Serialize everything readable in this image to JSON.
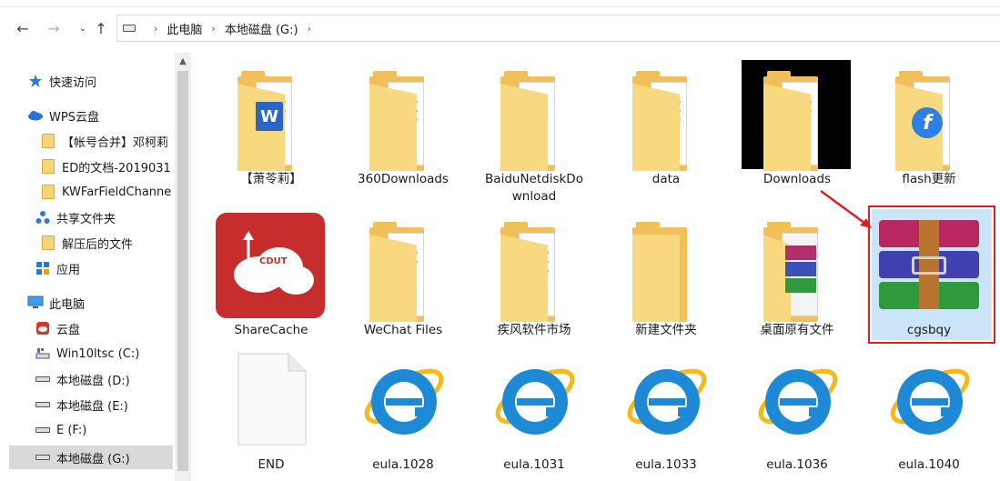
{
  "breadcrumb": [
    "此电脑",
    "本地磁盘 (G:)"
  ],
  "sidebar": {
    "items": [
      {
        "label": "快速访问",
        "icon": "pin-icon"
      },
      {
        "label": "WPS云盘",
        "icon": "cloud-icon"
      },
      {
        "label": "【帐号合并】邓柯莉",
        "icon": "folder-icon"
      },
      {
        "label": "ED的文档-2019031",
        "icon": "folder-icon"
      },
      {
        "label": "KWFarFieldChanne",
        "icon": "folder-icon"
      },
      {
        "label": "共享文件夹",
        "icon": "share-icon"
      },
      {
        "label": "解压后的文件",
        "icon": "folder-icon"
      },
      {
        "label": "应用",
        "icon": "apps-icon"
      },
      {
        "label": "此电脑",
        "icon": "computer-icon"
      },
      {
        "label": "云盘",
        "icon": "cloud-drive-icon"
      },
      {
        "label": "Win10ltsc (C:)",
        "icon": "system-drive-icon"
      },
      {
        "label": "本地磁盘 (D:)",
        "icon": "drive-icon"
      },
      {
        "label": "本地磁盘 (E:)",
        "icon": "drive-icon"
      },
      {
        "label": "E (F:)",
        "icon": "drive-icon"
      },
      {
        "label": "本地磁盘 (G:)",
        "icon": "drive-icon"
      }
    ],
    "selected": "本地磁盘 (G:)"
  },
  "files": [
    {
      "label": "【萧苓莉】",
      "icon": "word-folder-icon"
    },
    {
      "label": "360Downloads",
      "icon": "folder-icon"
    },
    {
      "label": "BaiduNetdiskDo",
      "label2": "wnload",
      "icon": "folder-icon"
    },
    {
      "label": "data",
      "icon": "folder-icon"
    },
    {
      "label": "Downloads",
      "icon": "folder-icon"
    },
    {
      "label": "flash更新",
      "icon": "flash-folder-icon"
    },
    {
      "label": "ShareCache",
      "icon": "sharecache-icon"
    },
    {
      "label": "WeChat Files",
      "icon": "folder-icon"
    },
    {
      "label": "疾风软件市场",
      "icon": "folder-icon"
    },
    {
      "label": "新建文件夹",
      "icon": "folder-icon"
    },
    {
      "label": "桌面原有文件",
      "icon": "winrar-folder-icon"
    },
    {
      "label": "cgsbqy",
      "icon": "winrar-archive-icon"
    },
    {
      "label": "END",
      "icon": "blank-file-icon"
    },
    {
      "label": "eula.1028",
      "icon": "ie-icon"
    },
    {
      "label": "eula.1031",
      "icon": "ie-icon"
    },
    {
      "label": "eula.1033",
      "icon": "ie-icon"
    },
    {
      "label": "eula.1036",
      "icon": "ie-icon"
    },
    {
      "label": "eula.1040",
      "icon": "ie-icon"
    }
  ],
  "sharecache_badge": "CDUT",
  "colors": {
    "highlight_border": "#e02020",
    "selection": "#cce4f7",
    "folder": "#f2c05a"
  }
}
